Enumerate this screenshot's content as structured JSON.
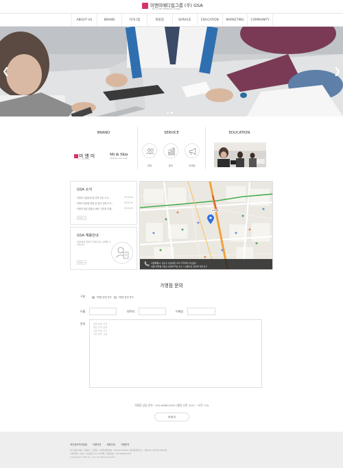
{
  "header": {
    "logo_text": "미앤미메디컬그룹 (주) GSA",
    "logo_sub": "Mi & Me Medical Group"
  },
  "nav": {
    "items": [
      "ABOUT US",
      "BRAND",
      "가이니점",
      "회원점",
      "SERVICE",
      "EDUCATION",
      "MARKETING",
      "COMMUNITY"
    ]
  },
  "sections": {
    "brand": {
      "title": "BRAND",
      "logo1": "미 앤 미",
      "logo1_sub": "MIANDMI",
      "logo2": "Mi & Skin",
      "logo2_sub": "GENERAL SKIN CARE"
    },
    "service": {
      "title": "SERVICE",
      "items": [
        "경영",
        "홍보",
        "마케팅"
      ]
    },
    "education": {
      "title": "EDUCATION"
    }
  },
  "news": {
    "title": "GSA 소식",
    "rows": [
      {
        "text": "미앤미 서울교대 점 안쪽 오픈 소식...",
        "date": "2018.05"
      },
      {
        "text": "미앤미 청담점 원장 분 출국 진행 소식...",
        "date": "2018.05"
      },
      {
        "text": "미앤미 청담 원장님 MBC 인터뷰 진행...",
        "date": "2018.05"
      }
    ],
    "more": "more +"
  },
  "hire": {
    "title": "GSA 채용안내",
    "desc": "GSA에서 함께 할 열정 있는 인재를 기다립니다.",
    "more": "more +"
  },
  "map": {
    "addr1": "서울특별시 서초구 서초대로 411 GT타워 (서초동)",
    "addr2": "서울 지하철 2호선 강남역 9번 출구 / 신분당선 강남역 4번 출구",
    "pin_label": "GT타워"
  },
  "form": {
    "title": "가맹점 문의",
    "type_label": "구분",
    "type_options": [
      "가맹점 창업 문의",
      "가맹점 운영 문의"
    ],
    "name_label": "이름",
    "phone_label": "연락처",
    "email_label": "이메일",
    "inquiry_label": "문의",
    "inquiry_placeholder": "창업 희망 지역\n예상 투자 금액\n개원 희망 시기\n기타 문의 사항",
    "note": "가맹점 상담 문의 : 070-8986-0000 (평일 오전 10시 ~ 오후 7시)",
    "submit": "보내기"
  },
  "footer": {
    "links": [
      "개인정보처리방침",
      "이용약관",
      "제휴안내",
      "가맹문의"
    ],
    "line1": "(주)지에스에이 | 대표자 : 홍길동 | 사업자등록번호 : 000-00-00000 | 통신판매업신고 : 제0000-서울서초-0000호",
    "line2": "서울특별시 서초구 서초대로 411 GT타워 | 대표번호 : 070-8986-0000",
    "line3": "Copyright © GSA Co., Ltd. All rights reserved."
  }
}
